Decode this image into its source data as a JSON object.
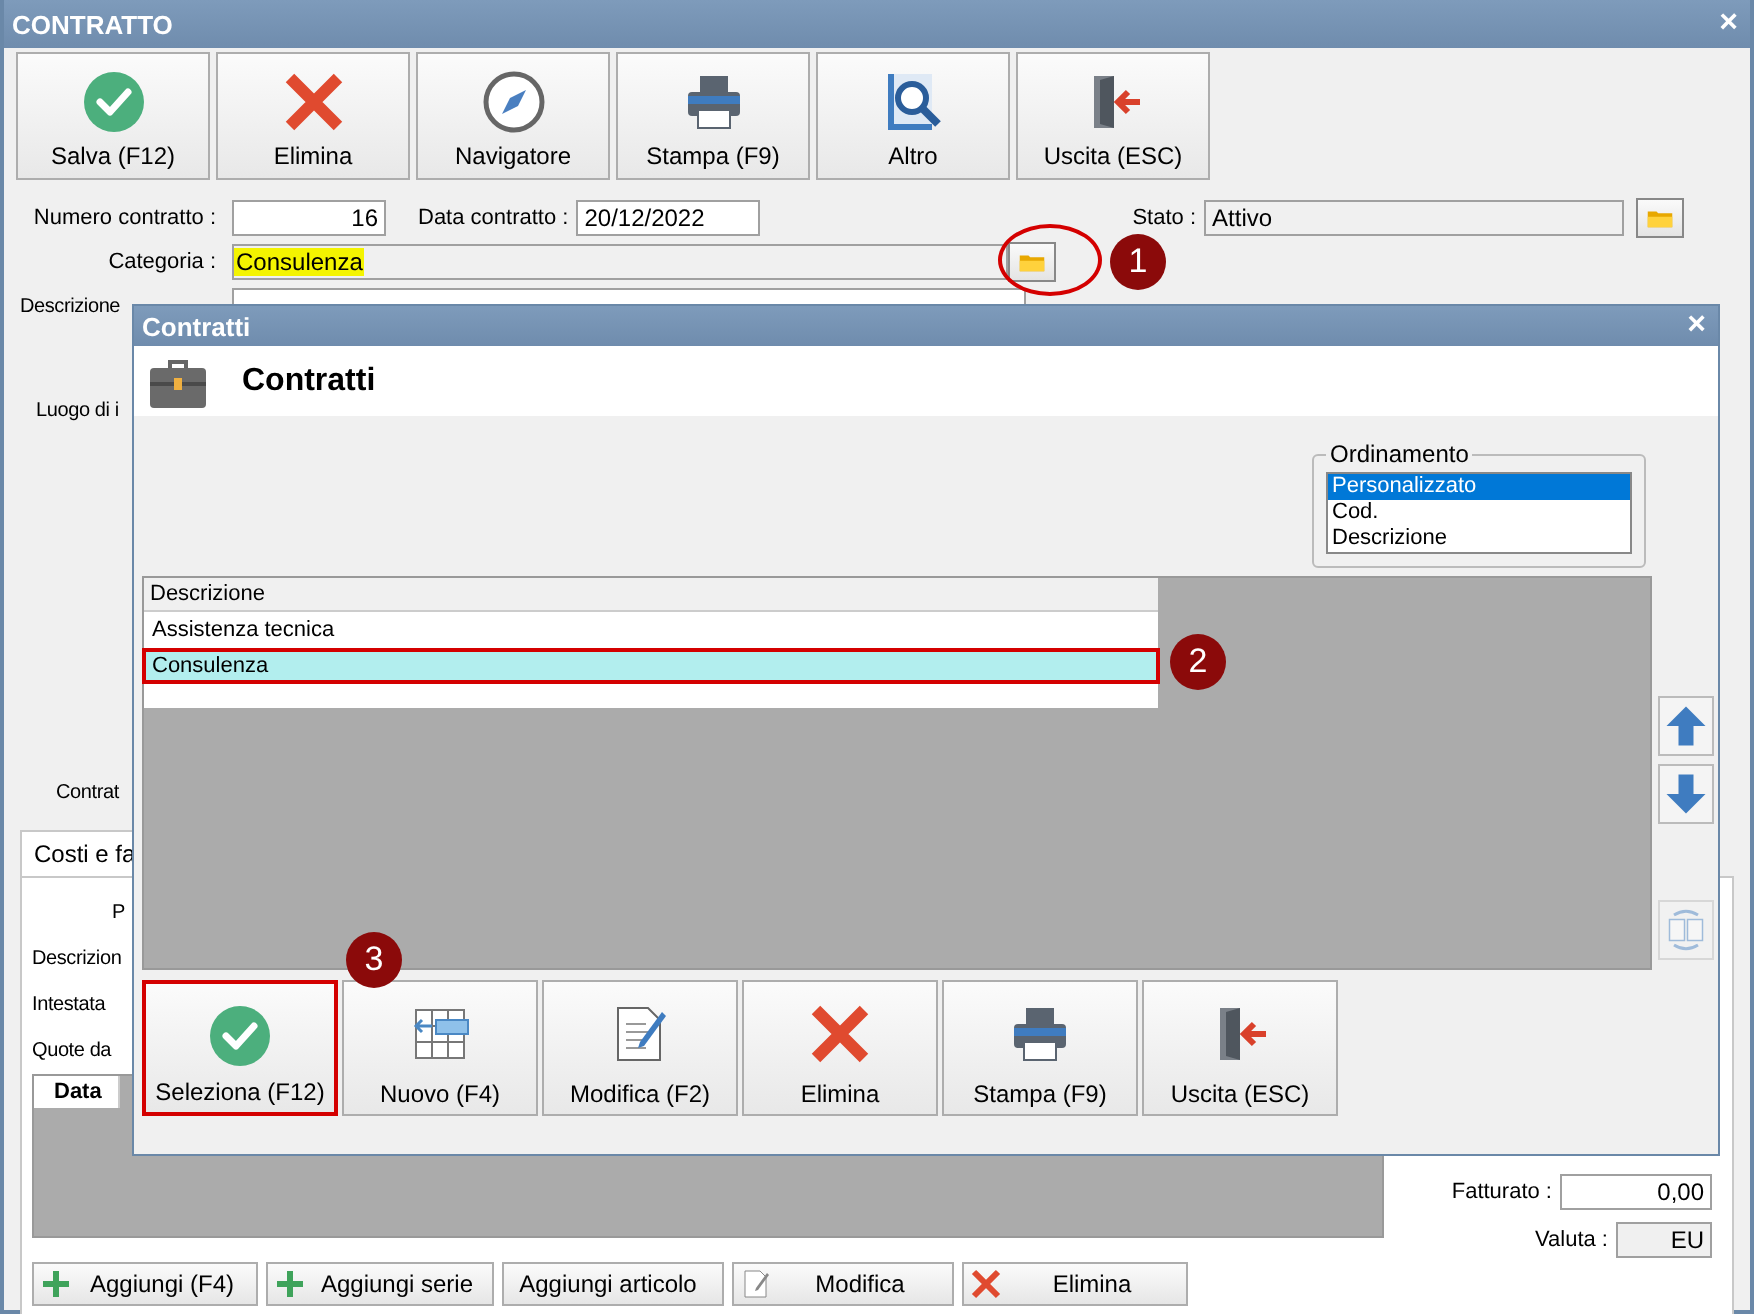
{
  "window": {
    "title": "CONTRATTO",
    "close": "×"
  },
  "toolbar": [
    {
      "label": "Salva (F12)",
      "kind": "check"
    },
    {
      "label": "Elimina",
      "kind": "cross"
    },
    {
      "label": "Navigatore",
      "kind": "compass"
    },
    {
      "label": "Stampa (F9)",
      "kind": "printer"
    },
    {
      "label": "Altro",
      "kind": "magnifier"
    },
    {
      "label": "Uscita (ESC)",
      "kind": "exit"
    }
  ],
  "form": {
    "numero_label": "Numero contratto :",
    "numero": "16",
    "data_label": "Data contratto :",
    "data": "20/12/2022",
    "stato_label": "Stato :",
    "stato": "Attivo",
    "categoria_label": "Categoria :",
    "categoria": "Consulenza",
    "descrizione_label": "Descrizione",
    "luogo_label": "Luogo di i",
    "contratto_label": "Contrat"
  },
  "tab": {
    "label": "Costi e fa",
    "selected": true
  },
  "tab_labels": [
    "P",
    "Descrizion",
    "Intestata",
    "Quote da"
  ],
  "grid_columns": [
    "Data"
  ],
  "totals": [
    {
      "label": "Fatturato :",
      "value": "0,00"
    },
    {
      "label": "Valuta :",
      "value": "EU"
    }
  ],
  "bottom_buttons": [
    {
      "label": "Aggiungi (F4)",
      "kind": "plus"
    },
    {
      "label": "Aggiungi serie",
      "kind": "plus"
    },
    {
      "label": "Aggiungi articolo",
      "kind": "text"
    },
    {
      "label": "Modifica",
      "kind": "edit"
    },
    {
      "label": "Elimina",
      "kind": "cross"
    }
  ],
  "dialog": {
    "title": "Contratti",
    "close": "×",
    "heading": "Contratti",
    "sort": {
      "label": "Ordinamento",
      "options": [
        {
          "label": "Personalizzato",
          "selected": true
        },
        {
          "label": "Cod.",
          "selected": false
        },
        {
          "label": "Descrizione",
          "selected": false
        }
      ]
    },
    "table": {
      "columns": [
        "Descrizione"
      ],
      "rows": [
        {
          "text": "Assistenza tecnica",
          "selected": false,
          "outlined": false
        },
        {
          "text": "Consulenza",
          "selected": true,
          "outlined": true
        }
      ]
    },
    "side_buttons": [
      {
        "kind": "up",
        "disabled": false
      },
      {
        "kind": "down",
        "disabled": false
      },
      {
        "kind": "swap",
        "disabled": true
      }
    ],
    "buttons": [
      {
        "label": "Seleziona (F12)",
        "kind": "check",
        "outlined": true
      },
      {
        "label": "Nuovo (F4)",
        "kind": "grid",
        "outlined": false
      },
      {
        "label": "Modifica (F2)",
        "kind": "editdoc",
        "outlined": false
      },
      {
        "label": "Elimina",
        "kind": "cross",
        "outlined": false
      },
      {
        "label": "Stampa (F9)",
        "kind": "printer",
        "outlined": false
      },
      {
        "label": "Uscita (ESC)",
        "kind": "exit",
        "outlined": false
      }
    ]
  },
  "callouts": [
    "1",
    "2",
    "3"
  ]
}
